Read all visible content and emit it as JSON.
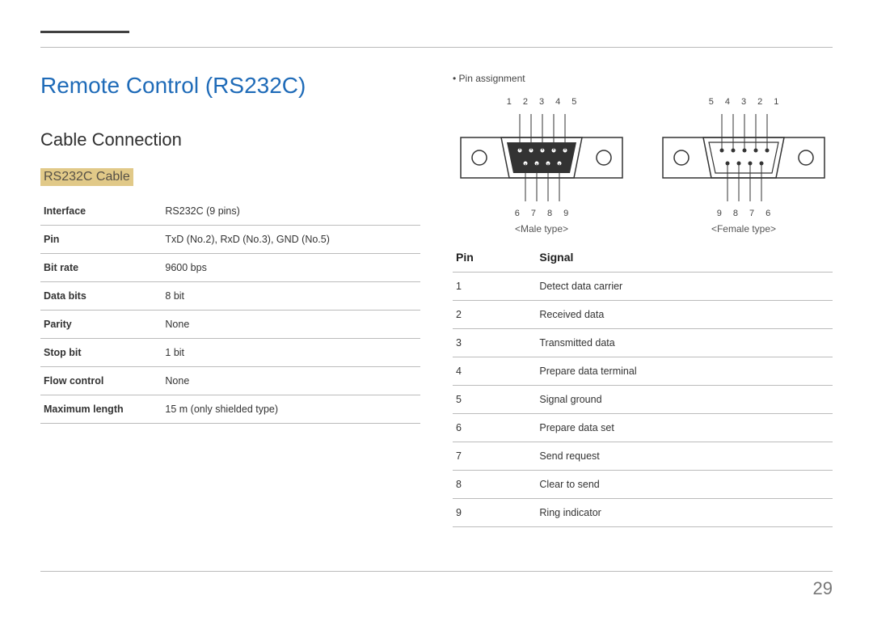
{
  "page": {
    "number": "29"
  },
  "title": "Remote Control (RS232C)",
  "section": "Cable Connection",
  "subsection": "RS232C Cable",
  "specs": [
    {
      "label": "Interface",
      "value": "RS232C (9 pins)"
    },
    {
      "label": "Pin",
      "value": "TxD (No.2), RxD (No.3), GND (No.5)"
    },
    {
      "label": "Bit rate",
      "value": "9600 bps"
    },
    {
      "label": "Data bits",
      "value": "8 bit"
    },
    {
      "label": "Parity",
      "value": "None"
    },
    {
      "label": "Stop bit",
      "value": "1 bit"
    },
    {
      "label": "Flow control",
      "value": "None"
    },
    {
      "label": "Maximum length",
      "value": "15 m (only shielded type)"
    }
  ],
  "right": {
    "bullet": "Pin assignment",
    "connectors": {
      "male": {
        "top": [
          "1",
          "2",
          "3",
          "4",
          "5"
        ],
        "bottom": [
          "6",
          "7",
          "8",
          "9"
        ],
        "caption": "<Male type>"
      },
      "female": {
        "top": [
          "5",
          "4",
          "3",
          "2",
          "1"
        ],
        "bottom": [
          "9",
          "8",
          "7",
          "6"
        ],
        "caption": "<Female type>"
      }
    },
    "signal_header": {
      "pin": "Pin",
      "signal": "Signal"
    },
    "signals": [
      {
        "pin": "1",
        "signal": "Detect data carrier"
      },
      {
        "pin": "2",
        "signal": "Received data"
      },
      {
        "pin": "3",
        "signal": "Transmitted data"
      },
      {
        "pin": "4",
        "signal": "Prepare data terminal"
      },
      {
        "pin": "5",
        "signal": "Signal ground"
      },
      {
        "pin": "6",
        "signal": "Prepare data set"
      },
      {
        "pin": "7",
        "signal": "Send request"
      },
      {
        "pin": "8",
        "signal": "Clear to send"
      },
      {
        "pin": "9",
        "signal": "Ring indicator"
      }
    ]
  }
}
